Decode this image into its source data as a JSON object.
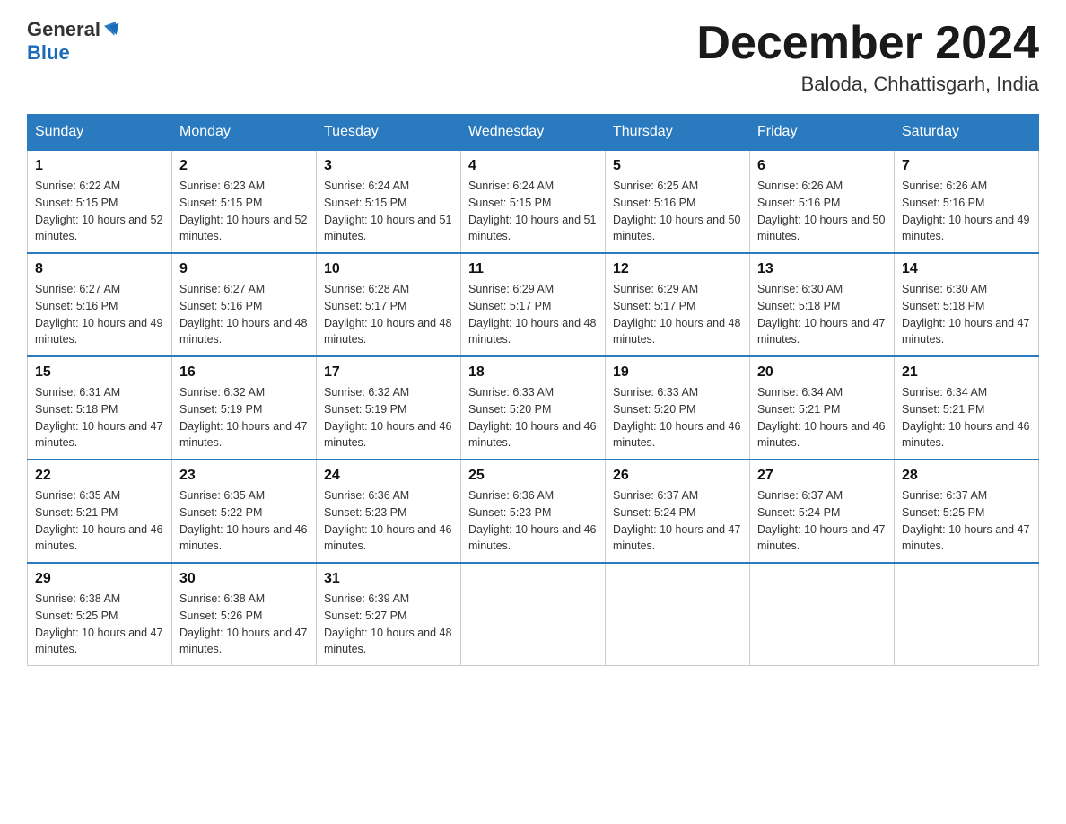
{
  "header": {
    "logo_general": "General",
    "logo_blue": "Blue",
    "month_title": "December 2024",
    "location": "Baloda, Chhattisgarh, India"
  },
  "days_of_week": [
    "Sunday",
    "Monday",
    "Tuesday",
    "Wednesday",
    "Thursday",
    "Friday",
    "Saturday"
  ],
  "weeks": [
    [
      {
        "day": "1",
        "sunrise": "6:22 AM",
        "sunset": "5:15 PM",
        "daylight": "10 hours and 52 minutes."
      },
      {
        "day": "2",
        "sunrise": "6:23 AM",
        "sunset": "5:15 PM",
        "daylight": "10 hours and 52 minutes."
      },
      {
        "day": "3",
        "sunrise": "6:24 AM",
        "sunset": "5:15 PM",
        "daylight": "10 hours and 51 minutes."
      },
      {
        "day": "4",
        "sunrise": "6:24 AM",
        "sunset": "5:15 PM",
        "daylight": "10 hours and 51 minutes."
      },
      {
        "day": "5",
        "sunrise": "6:25 AM",
        "sunset": "5:16 PM",
        "daylight": "10 hours and 50 minutes."
      },
      {
        "day": "6",
        "sunrise": "6:26 AM",
        "sunset": "5:16 PM",
        "daylight": "10 hours and 50 minutes."
      },
      {
        "day": "7",
        "sunrise": "6:26 AM",
        "sunset": "5:16 PM",
        "daylight": "10 hours and 49 minutes."
      }
    ],
    [
      {
        "day": "8",
        "sunrise": "6:27 AM",
        "sunset": "5:16 PM",
        "daylight": "10 hours and 49 minutes."
      },
      {
        "day": "9",
        "sunrise": "6:27 AM",
        "sunset": "5:16 PM",
        "daylight": "10 hours and 48 minutes."
      },
      {
        "day": "10",
        "sunrise": "6:28 AM",
        "sunset": "5:17 PM",
        "daylight": "10 hours and 48 minutes."
      },
      {
        "day": "11",
        "sunrise": "6:29 AM",
        "sunset": "5:17 PM",
        "daylight": "10 hours and 48 minutes."
      },
      {
        "day": "12",
        "sunrise": "6:29 AM",
        "sunset": "5:17 PM",
        "daylight": "10 hours and 48 minutes."
      },
      {
        "day": "13",
        "sunrise": "6:30 AM",
        "sunset": "5:18 PM",
        "daylight": "10 hours and 47 minutes."
      },
      {
        "day": "14",
        "sunrise": "6:30 AM",
        "sunset": "5:18 PM",
        "daylight": "10 hours and 47 minutes."
      }
    ],
    [
      {
        "day": "15",
        "sunrise": "6:31 AM",
        "sunset": "5:18 PM",
        "daylight": "10 hours and 47 minutes."
      },
      {
        "day": "16",
        "sunrise": "6:32 AM",
        "sunset": "5:19 PM",
        "daylight": "10 hours and 47 minutes."
      },
      {
        "day": "17",
        "sunrise": "6:32 AM",
        "sunset": "5:19 PM",
        "daylight": "10 hours and 46 minutes."
      },
      {
        "day": "18",
        "sunrise": "6:33 AM",
        "sunset": "5:20 PM",
        "daylight": "10 hours and 46 minutes."
      },
      {
        "day": "19",
        "sunrise": "6:33 AM",
        "sunset": "5:20 PM",
        "daylight": "10 hours and 46 minutes."
      },
      {
        "day": "20",
        "sunrise": "6:34 AM",
        "sunset": "5:21 PM",
        "daylight": "10 hours and 46 minutes."
      },
      {
        "day": "21",
        "sunrise": "6:34 AM",
        "sunset": "5:21 PM",
        "daylight": "10 hours and 46 minutes."
      }
    ],
    [
      {
        "day": "22",
        "sunrise": "6:35 AM",
        "sunset": "5:21 PM",
        "daylight": "10 hours and 46 minutes."
      },
      {
        "day": "23",
        "sunrise": "6:35 AM",
        "sunset": "5:22 PM",
        "daylight": "10 hours and 46 minutes."
      },
      {
        "day": "24",
        "sunrise": "6:36 AM",
        "sunset": "5:23 PM",
        "daylight": "10 hours and 46 minutes."
      },
      {
        "day": "25",
        "sunrise": "6:36 AM",
        "sunset": "5:23 PM",
        "daylight": "10 hours and 46 minutes."
      },
      {
        "day": "26",
        "sunrise": "6:37 AM",
        "sunset": "5:24 PM",
        "daylight": "10 hours and 47 minutes."
      },
      {
        "day": "27",
        "sunrise": "6:37 AM",
        "sunset": "5:24 PM",
        "daylight": "10 hours and 47 minutes."
      },
      {
        "day": "28",
        "sunrise": "6:37 AM",
        "sunset": "5:25 PM",
        "daylight": "10 hours and 47 minutes."
      }
    ],
    [
      {
        "day": "29",
        "sunrise": "6:38 AM",
        "sunset": "5:25 PM",
        "daylight": "10 hours and 47 minutes."
      },
      {
        "day": "30",
        "sunrise": "6:38 AM",
        "sunset": "5:26 PM",
        "daylight": "10 hours and 47 minutes."
      },
      {
        "day": "31",
        "sunrise": "6:39 AM",
        "sunset": "5:27 PM",
        "daylight": "10 hours and 48 minutes."
      },
      null,
      null,
      null,
      null
    ]
  ],
  "labels": {
    "sunrise_prefix": "Sunrise: ",
    "sunset_prefix": "Sunset: ",
    "daylight_prefix": "Daylight: "
  }
}
